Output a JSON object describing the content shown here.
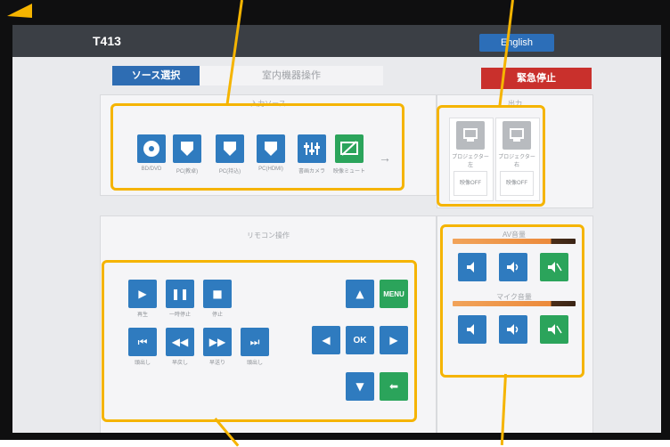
{
  "header": {
    "room": "T413",
    "language_button": "English"
  },
  "tabs": [
    {
      "label": "ソース選択"
    },
    {
      "label": "室内機器操作"
    }
  ],
  "emergency_stop": "緊急停止",
  "panels": {
    "source_title": "入力ソース",
    "output_title": "出力",
    "remote_title": "リモコン操作",
    "av_volume_title": "AV音量",
    "mic_volume_title": "マイク音量"
  },
  "sources": [
    {
      "icon": "disc-icon",
      "label": "BD/DVD"
    },
    {
      "icon": "shield-icon",
      "label": "PC(教卓)"
    },
    {
      "icon": "shield-icon",
      "label": "PC(持込)"
    },
    {
      "icon": "shield-icon",
      "label": "PC(HDMI)"
    },
    {
      "icon": "equalizer-icon",
      "label": "書画カメラ"
    },
    {
      "icon": "no-display-icon",
      "label": "映像ミュート"
    }
  ],
  "outputs": [
    {
      "icon": "projector-icon",
      "label": "プロジェクター左",
      "sub": "映像OFF"
    },
    {
      "icon": "projector-icon",
      "label": "プロジェクター右",
      "sub": "映像OFF"
    }
  ],
  "remote": {
    "play_label": "再生",
    "pause_label": "一時停止",
    "stop_label": "停止",
    "prev_label": "頭出し",
    "rewind_label": "早戻し",
    "forward_label": "早送り",
    "next_label": "頭出し",
    "menu": "MENU",
    "ok": "OK"
  },
  "colors": {
    "accent_blue": "#2f7bbf",
    "accent_green": "#2ba45b",
    "emergency_red": "#c9302c",
    "highlight": "#f5b400"
  }
}
